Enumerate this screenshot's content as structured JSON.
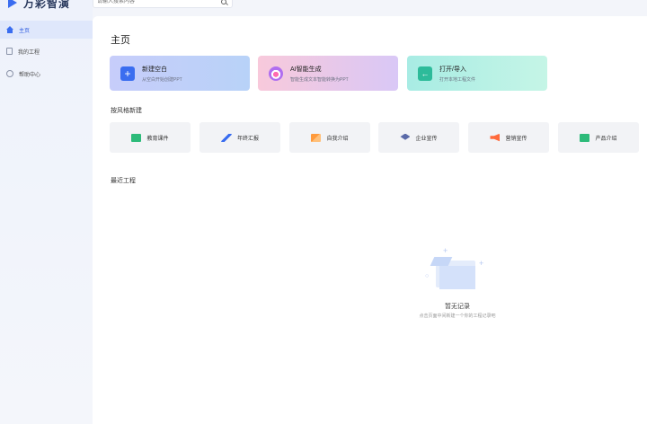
{
  "app": {
    "name": "万彩智演"
  },
  "search": {
    "placeholder": "请输入搜索内容"
  },
  "sidebar": {
    "items": [
      {
        "label": "主页",
        "icon": "home-icon",
        "active": true
      },
      {
        "label": "我的工程",
        "icon": "document-icon",
        "active": false
      },
      {
        "label": "帮助中心",
        "icon": "help-icon",
        "active": false
      }
    ]
  },
  "main": {
    "title": "主页",
    "actions": [
      {
        "title": "新建空白",
        "subtitle": "从空白开始创建PPT",
        "icon": "plus-icon"
      },
      {
        "title": "AI智能生成",
        "subtitle": "智能生成文本智能转换为PPT",
        "icon": "ai-icon"
      },
      {
        "title": "打开/导入",
        "subtitle": "打开本地工程文件",
        "icon": "import-icon"
      }
    ],
    "style_section_title": "按风格新建",
    "styles": [
      {
        "label": "教育课件",
        "icon": "education-icon"
      },
      {
        "label": "年终汇报",
        "icon": "report-icon"
      },
      {
        "label": "自我介绍",
        "icon": "self-intro-icon"
      },
      {
        "label": "企业宣传",
        "icon": "corporate-icon"
      },
      {
        "label": "营销宣传",
        "icon": "marketing-icon"
      },
      {
        "label": "产品介绍",
        "icon": "product-icon"
      }
    ],
    "recent_section_title": "最近工程",
    "empty": {
      "title": "暂无记录",
      "subtitle": "点击页面中间新建一个你的工程记录吧"
    }
  },
  "colors": {
    "accent": "#3a6df0",
    "sidebar_active_bg": "#dfe7fb"
  }
}
